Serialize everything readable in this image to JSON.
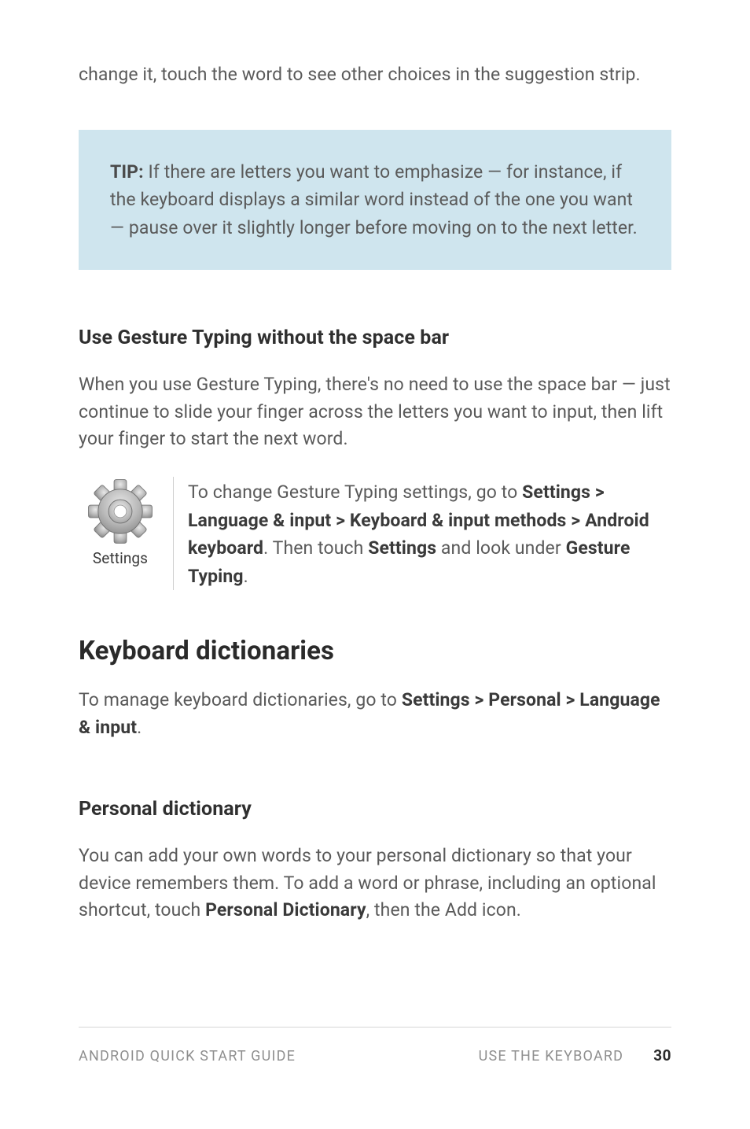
{
  "intro": "change it, touch the word to see other choices in the suggestion strip.",
  "tip": {
    "label": "TIP:",
    "text": " If there are letters you want to emphasize — for instance, if the keyboard displays a similar word instead of the one you want — pause over it slightly longer before moving on to the next letter."
  },
  "section1": {
    "heading": "Use Gesture Typing without the space bar",
    "para": "When you use Gesture Typing, there's no need to use the space bar — just continue to slide your finger across the letters you want to input, then lift your finger to start the next word.",
    "icon_caption": "Settings",
    "icon_para_pre": "To change Gesture Typing settings, go to ",
    "icon_para_strong1": "Settings > Language & input > Keyboard & input methods > Android keyboard",
    "icon_para_mid1": ". Then touch ",
    "icon_para_strong2": "Settings",
    "icon_para_mid2": " and look under ",
    "icon_para_strong3": "Gesture Typing",
    "icon_para_post": "."
  },
  "section2": {
    "heading": "Keyboard dictionaries",
    "para_pre": "To manage keyboard dictionaries, go to ",
    "para_strong": "Settings > Personal > Language & input",
    "para_post": "."
  },
  "section3": {
    "heading": "Personal dictionary",
    "para_pre": "You can add your own words to your personal dictionary so that your device remembers them. To add a word or phrase, including an optional shortcut, touch ",
    "para_strong": "Personal Dictionary",
    "para_post": ", then the Add icon."
  },
  "footer": {
    "left": "ANDROID QUICK START GUIDE",
    "right": "USE THE KEYBOARD",
    "page": "30"
  }
}
